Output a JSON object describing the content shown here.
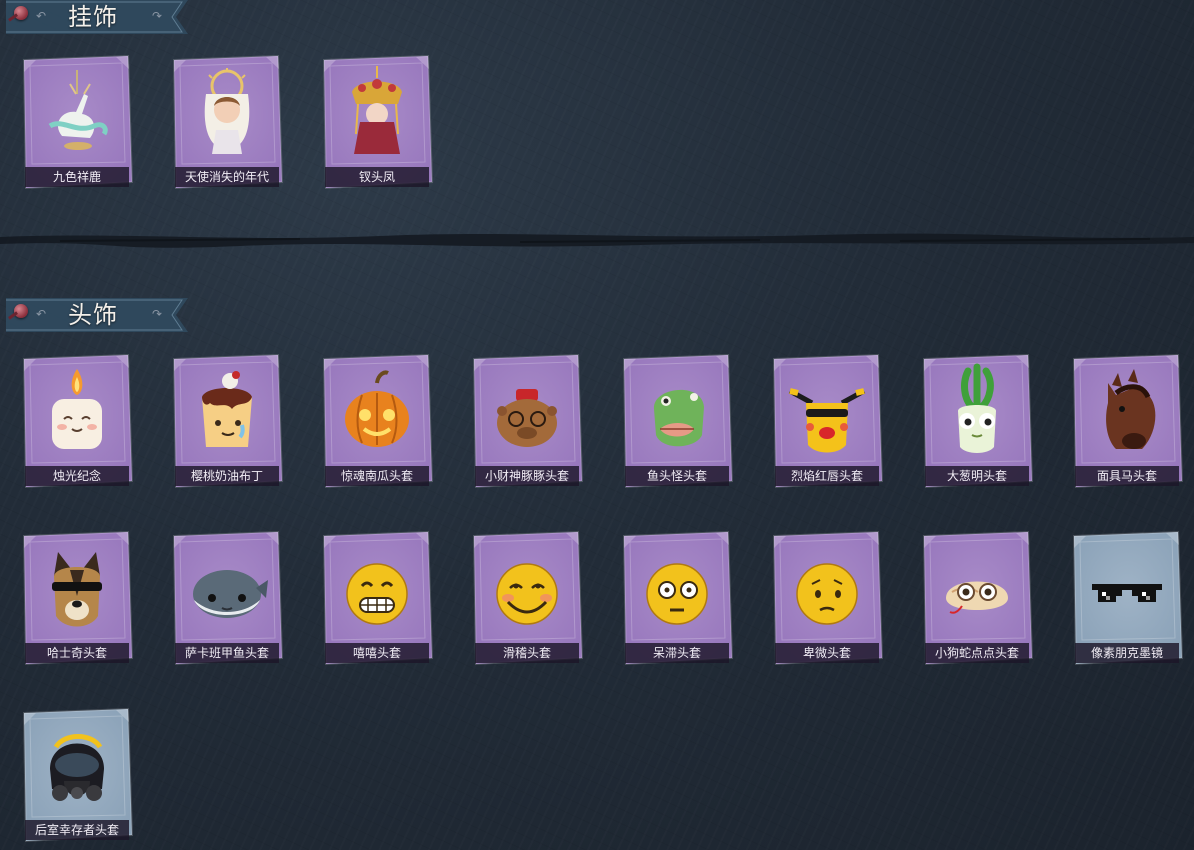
{
  "sections": [
    {
      "title": "挂饰",
      "items": [
        {
          "label": "九色祥鹿",
          "icon": "deer-pendant-icon",
          "rarity": "purple"
        },
        {
          "label": "天使消失的年代",
          "icon": "angel-doll-pendant-icon",
          "rarity": "purple"
        },
        {
          "label": "钗头凤",
          "icon": "phoenix-crown-pendant-icon",
          "rarity": "purple"
        }
      ]
    },
    {
      "title": "头饰",
      "items": [
        {
          "label": "烛光纪念",
          "icon": "candle-icon",
          "rarity": "purple"
        },
        {
          "label": "樱桃奶油布丁",
          "icon": "pudding-icon",
          "rarity": "purple"
        },
        {
          "label": "惊魂南瓜头套",
          "icon": "pumpkin-head-icon",
          "rarity": "purple"
        },
        {
          "label": "小财神豚豚头套",
          "icon": "capybara-head-icon",
          "rarity": "purple"
        },
        {
          "label": "鱼头怪头套",
          "icon": "fish-head-icon",
          "rarity": "purple"
        },
        {
          "label": "烈焰红唇头套",
          "icon": "yellow-mask-icon",
          "rarity": "purple"
        },
        {
          "label": "大葱明头套",
          "icon": "scallion-head-icon",
          "rarity": "purple"
        },
        {
          "label": "面具马头套",
          "icon": "horse-head-icon",
          "rarity": "purple"
        },
        {
          "label": "哈士奇头套",
          "icon": "husky-head-icon",
          "rarity": "purple"
        },
        {
          "label": "萨卡班甲鱼头套",
          "icon": "sacabambaspis-head-icon",
          "rarity": "purple"
        },
        {
          "label": "嘻嘻头套",
          "icon": "grin-emoji-head-icon",
          "rarity": "purple"
        },
        {
          "label": "滑稽头套",
          "icon": "funny-emoji-head-icon",
          "rarity": "purple"
        },
        {
          "label": "呆滞头套",
          "icon": "dazed-emoji-head-icon",
          "rarity": "purple"
        },
        {
          "label": "卑微头套",
          "icon": "pleading-emoji-head-icon",
          "rarity": "purple"
        },
        {
          "label": "小狗蛇点点头套",
          "icon": "snake-head-icon",
          "rarity": "purple"
        },
        {
          "label": "像素朋克墨镜",
          "icon": "pixel-sunglasses-icon",
          "rarity": "blue"
        },
        {
          "label": "后室幸存者头套",
          "icon": "gas-mask-helmet-icon",
          "rarity": "blue"
        }
      ]
    }
  ],
  "colors": {
    "background": "#222c38",
    "rarity_purple": "#a88bc8",
    "rarity_blue": "#9fb3c6",
    "label_text": "#f2eef6",
    "title_text": "#f4f0ea"
  }
}
